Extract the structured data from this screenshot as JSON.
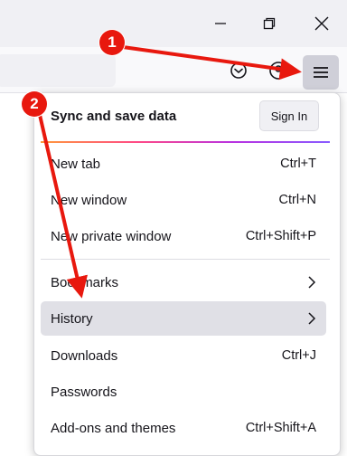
{
  "panel": {
    "sync_label": "Sync and save data",
    "signin_label": "Sign In"
  },
  "menu_items": [
    {
      "label": "New tab",
      "shortcut": "Ctrl+T"
    },
    {
      "label": "New window",
      "shortcut": "Ctrl+N"
    },
    {
      "label": "New private window",
      "shortcut": "Ctrl+Shift+P"
    },
    {
      "label": "Bookmarks",
      "shortcut": ""
    },
    {
      "label": "History",
      "shortcut": ""
    },
    {
      "label": "Downloads",
      "shortcut": "Ctrl+J"
    },
    {
      "label": "Passwords",
      "shortcut": ""
    },
    {
      "label": "Add-ons and themes",
      "shortcut": "Ctrl+Shift+A"
    }
  ],
  "annotations": {
    "step1": "1",
    "step2": "2"
  },
  "colors": {
    "annotation_red": "#e8180e",
    "highlight": "#e0e0e6",
    "menu_button_bg": "#cfcfd8"
  },
  "icons": [
    "minimize-icon",
    "restore-icon",
    "close-icon",
    "pocket-icon",
    "account-icon",
    "hamburger-menu-icon",
    "chevron-right-icon"
  ]
}
